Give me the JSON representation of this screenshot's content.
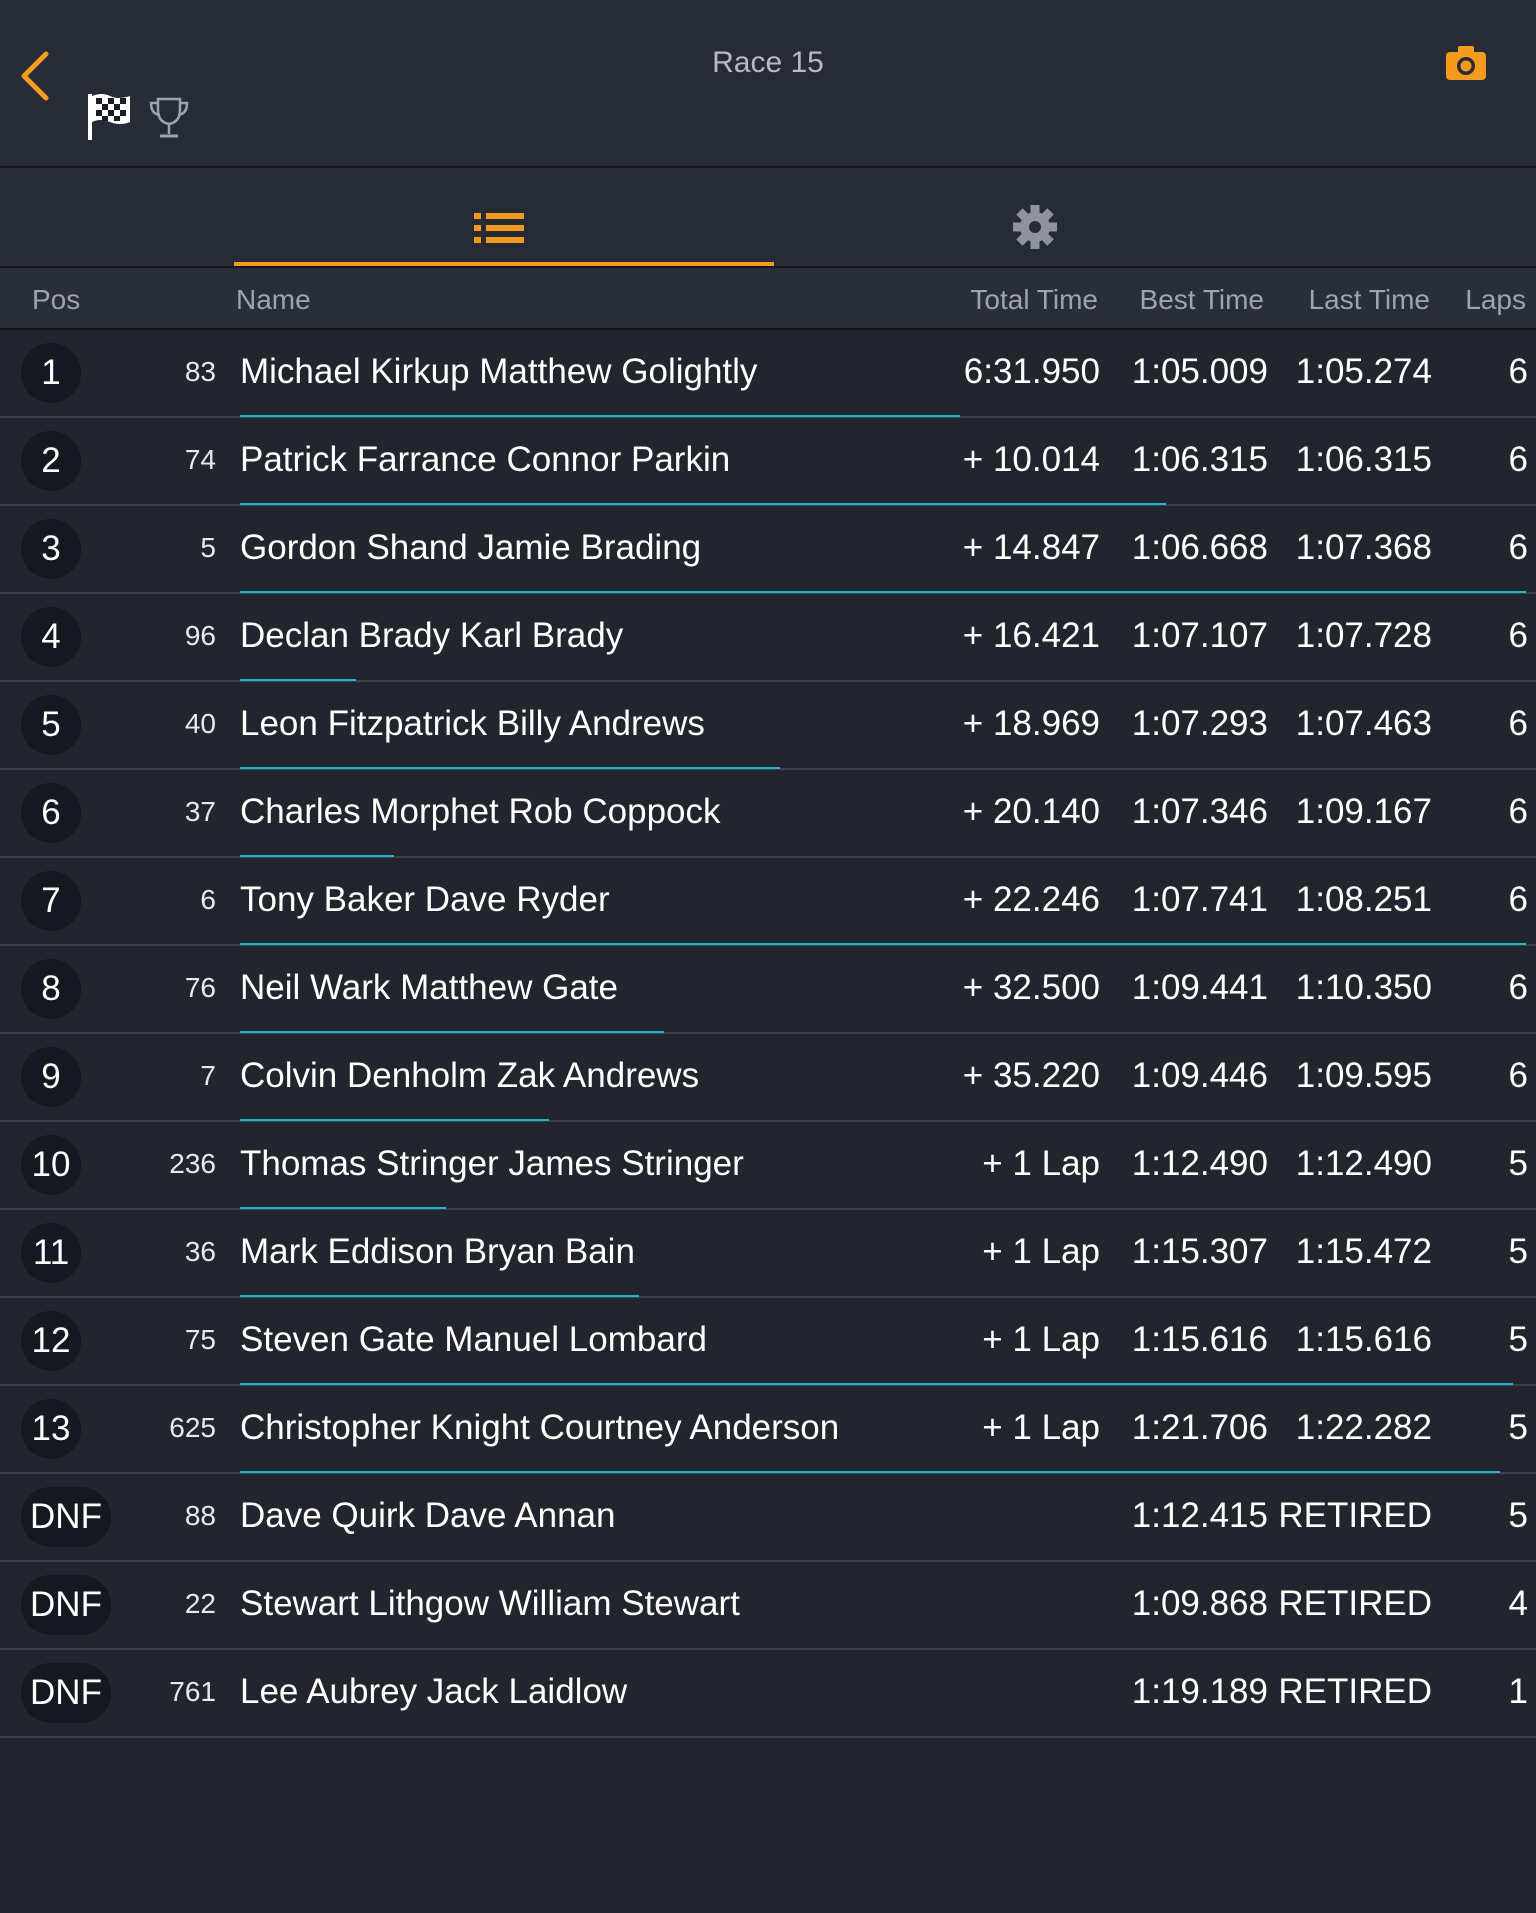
{
  "header": {
    "title": "Race 15",
    "icons": [
      "chevron-left-icon",
      "checkered-flag-icon",
      "trophy-icon",
      "camera-icon"
    ],
    "accent_color": "#f39a1f"
  },
  "tabs": [
    {
      "name": "results-list",
      "icon": "list-icon",
      "active": true
    },
    {
      "name": "settings",
      "icon": "gear-icon",
      "active": false
    }
  ],
  "columns": {
    "pos": "Pos",
    "name": "Name",
    "total": "Total Time",
    "best": "Best Time",
    "last": "Last Time",
    "laps": "Laps"
  },
  "progress_color": "#1fb6d6",
  "rows": [
    {
      "pos": "1",
      "num": "83",
      "name": "Michael Kirkup Matthew Golightly",
      "total": "6:31.950",
      "best": "1:05.009",
      "last": "1:05.274",
      "laps": "6",
      "progress": 0.56
    },
    {
      "pos": "2",
      "num": "74",
      "name": "Patrick Farrance Connor Parkin",
      "total": "+ 10.014",
      "best": "1:06.315",
      "last": "1:06.315",
      "laps": "6",
      "progress": 0.72
    },
    {
      "pos": "3",
      "num": "5",
      "name": "Gordon Shand Jamie Brading",
      "total": "+ 14.847",
      "best": "1:06.668",
      "last": "1:07.368",
      "laps": "6",
      "progress": 1.0
    },
    {
      "pos": "4",
      "num": "96",
      "name": "Declan Brady Karl Brady",
      "total": "+ 16.421",
      "best": "1:07.107",
      "last": "1:07.728",
      "laps": "6",
      "progress": 0.09
    },
    {
      "pos": "5",
      "num": "40",
      "name": "Leon Fitzpatrick Billy Andrews",
      "total": "+ 18.969",
      "best": "1:07.293",
      "last": "1:07.463",
      "laps": "6",
      "progress": 0.42
    },
    {
      "pos": "6",
      "num": "37",
      "name": "Charles Morphet Rob Coppock",
      "total": "+ 20.140",
      "best": "1:07.346",
      "last": "1:09.167",
      "laps": "6",
      "progress": 0.12
    },
    {
      "pos": "7",
      "num": "6",
      "name": "Tony Baker Dave Ryder",
      "total": "+ 22.246",
      "best": "1:07.741",
      "last": "1:08.251",
      "laps": "6",
      "progress": 1.0
    },
    {
      "pos": "8",
      "num": "76",
      "name": "Neil Wark Matthew Gate",
      "total": "+ 32.500",
      "best": "1:09.441",
      "last": "1:10.350",
      "laps": "6",
      "progress": 0.33
    },
    {
      "pos": "9",
      "num": "7",
      "name": "Colvin Denholm Zak Andrews",
      "total": "+ 35.220",
      "best": "1:09.446",
      "last": "1:09.595",
      "laps": "6",
      "progress": 0.24
    },
    {
      "pos": "10",
      "num": "236",
      "name": "Thomas Stringer James Stringer",
      "total": "+ 1 Lap",
      "best": "1:12.490",
      "last": "1:12.490",
      "laps": "5",
      "progress": 0.16
    },
    {
      "pos": "11",
      "num": "36",
      "name": "Mark Eddison Bryan Bain",
      "total": "+ 1 Lap",
      "best": "1:15.307",
      "last": "1:15.472",
      "laps": "5",
      "progress": 0.31
    },
    {
      "pos": "12",
      "num": "75",
      "name": "Steven Gate Manuel Lombard",
      "total": "+ 1 Lap",
      "best": "1:15.616",
      "last": "1:15.616",
      "laps": "5",
      "progress": 0.99
    },
    {
      "pos": "13",
      "num": "625",
      "name": "Christopher Knight Courtney Anderson",
      "total": "+ 1 Lap",
      "best": "1:21.706",
      "last": "1:22.282",
      "laps": "5",
      "progress": 0.98
    },
    {
      "pos": "DNF",
      "num": "88",
      "name": "Dave Quirk Dave Annan",
      "total": "",
      "best": "1:12.415",
      "last": "RETIRED",
      "laps": "5",
      "progress": 0
    },
    {
      "pos": "DNF",
      "num": "22",
      "name": "Stewart Lithgow William Stewart",
      "total": "",
      "best": "1:09.868",
      "last": "RETIRED",
      "laps": "4",
      "progress": 0
    },
    {
      "pos": "DNF",
      "num": "761",
      "name": "Lee Aubrey Jack Laidlow",
      "total": "",
      "best": "1:19.189",
      "last": "RETIRED",
      "laps": "1",
      "progress": 0
    }
  ]
}
